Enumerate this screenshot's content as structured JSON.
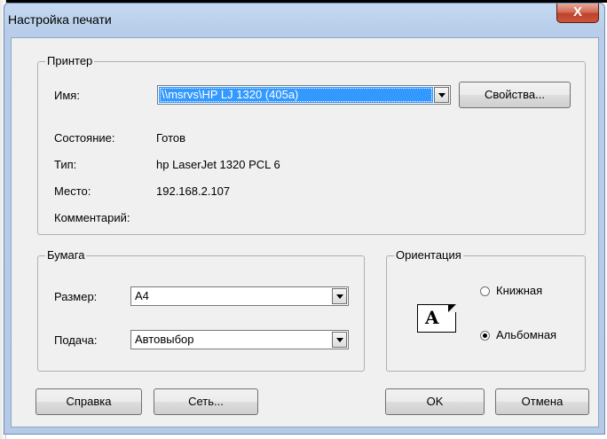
{
  "dialog": {
    "title": "Настройка печати",
    "close_label": "X"
  },
  "printer": {
    "legend": "Принтер",
    "name_label": "Имя:",
    "name_value": "\\\\msrvs\\HP LJ 1320 (405a)",
    "properties_label": "Свойства...",
    "status_label": "Состояние:",
    "status_value": "Готов",
    "type_label": "Тип:",
    "type_value": "hp LaserJet 1320 PCL 6",
    "place_label": "Место:",
    "place_value": "192.168.2.107",
    "comment_label": "Комментарий:",
    "comment_value": ""
  },
  "paper": {
    "legend": "Бумага",
    "size_label": "Размер:",
    "size_value": "A4",
    "source_label": "Подача:",
    "source_value": "Автовыбор"
  },
  "orientation": {
    "legend": "Ориентация",
    "icon_glyph": "A",
    "portrait_label": "Книжная",
    "landscape_label": "Альбомная",
    "selected": "landscape"
  },
  "buttons": {
    "help": "Справка",
    "network": "Сеть...",
    "ok": "OK",
    "cancel": "Отмена"
  }
}
